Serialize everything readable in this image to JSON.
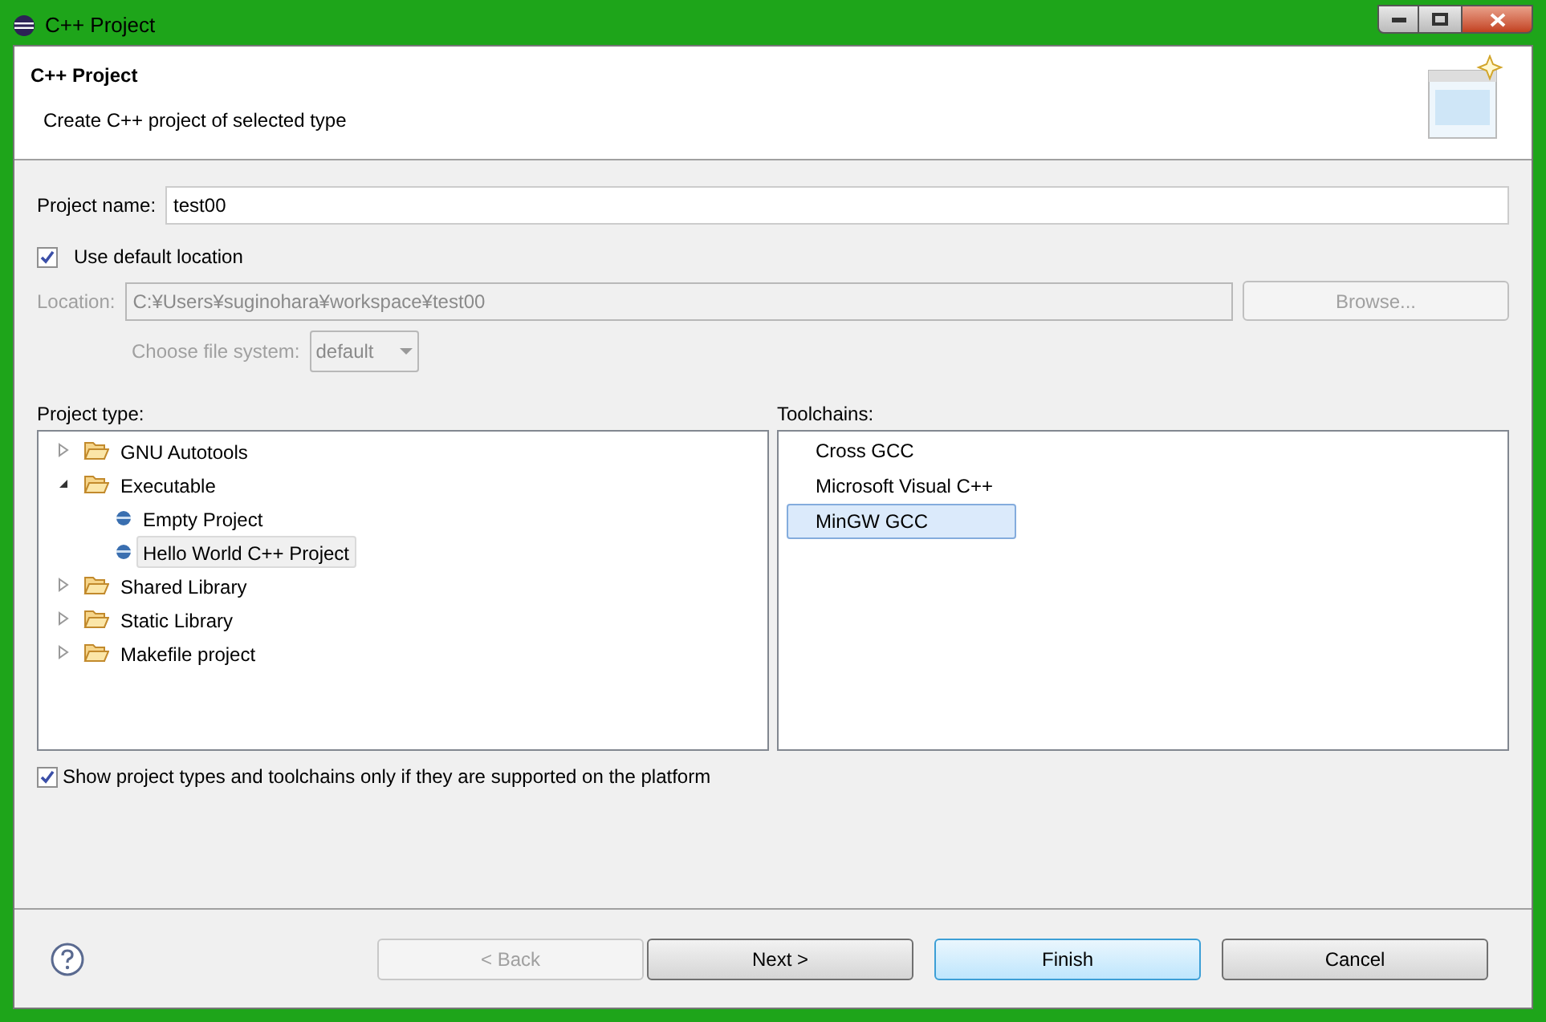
{
  "window": {
    "title": "C++ Project"
  },
  "header": {
    "title": "C++ Project",
    "subtitle": "Create C++ project of selected type"
  },
  "project_name": {
    "label": "Project name:",
    "value": "test00"
  },
  "use_default_location": {
    "label": "Use default location",
    "checked": true
  },
  "location": {
    "label": "Location:",
    "value": "C:¥Users¥suginohara¥workspace¥test00",
    "disabled": true
  },
  "browse_button": {
    "label": "Browse...",
    "disabled": true
  },
  "file_system": {
    "label": "Choose file system:",
    "value": "default",
    "disabled": true
  },
  "project_type": {
    "label": "Project type:",
    "tree": [
      {
        "label": "GNU Autotools",
        "kind": "folder",
        "expanded": false,
        "selected": false
      },
      {
        "label": "Executable",
        "kind": "folder",
        "expanded": true,
        "selected": false,
        "children": [
          {
            "label": "Empty Project",
            "kind": "template",
            "selected": false
          },
          {
            "label": "Hello World C++ Project",
            "kind": "template",
            "selected": true
          }
        ]
      },
      {
        "label": "Shared Library",
        "kind": "folder",
        "expanded": false,
        "selected": false
      },
      {
        "label": "Static Library",
        "kind": "folder",
        "expanded": false,
        "selected": false
      },
      {
        "label": "Makefile project",
        "kind": "folder",
        "expanded": false,
        "selected": false
      }
    ]
  },
  "toolchains": {
    "label": "Toolchains:",
    "items": [
      {
        "label": "Cross GCC",
        "selected": false
      },
      {
        "label": "Microsoft Visual C++",
        "selected": false
      },
      {
        "label": "MinGW GCC",
        "selected": true
      }
    ]
  },
  "show_supported": {
    "label": "Show project types and toolchains only if they are supported on the platform",
    "checked": true
  },
  "buttons": [
    {
      "label": "< Back",
      "disabled": true,
      "default": false
    },
    {
      "label": "Next >",
      "disabled": false,
      "default": false
    },
    {
      "label": "Finish",
      "disabled": false,
      "default": true
    },
    {
      "label": "Cancel",
      "disabled": false,
      "default": false
    }
  ]
}
